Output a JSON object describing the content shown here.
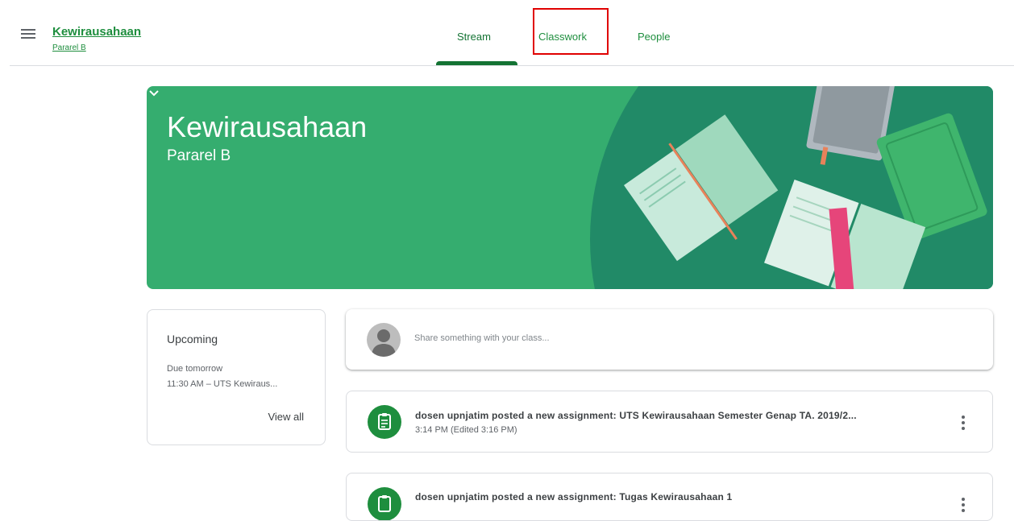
{
  "header": {
    "class_name": "Kewirausahaan",
    "class_section": "Pararel B",
    "tabs": [
      {
        "label": "Stream",
        "active": true
      },
      {
        "label": "Classwork",
        "active": false,
        "highlighted": true
      },
      {
        "label": "People",
        "active": false
      }
    ]
  },
  "banner": {
    "title": "Kewirausahaan",
    "subtitle": "Pararel B",
    "color": "#35ad6f"
  },
  "upcoming": {
    "title": "Upcoming",
    "due_label": "Due tomorrow",
    "item": "11:30 AM – UTS Kewiraus...",
    "view_all": "View all"
  },
  "share": {
    "placeholder": "Share something with your class..."
  },
  "posts": [
    {
      "text": "dosen upnjatim posted a new assignment: UTS Kewirausahaan Semester Genap TA. 2019/2...",
      "time": "3:14 PM (Edited 3:16 PM)"
    },
    {
      "text": "dosen upnjatim posted a new assignment: Tugas Kewirausahaan 1",
      "time": ""
    }
  ],
  "colors": {
    "accent": "#1e8e3e",
    "highlight_box": "#e00000"
  }
}
